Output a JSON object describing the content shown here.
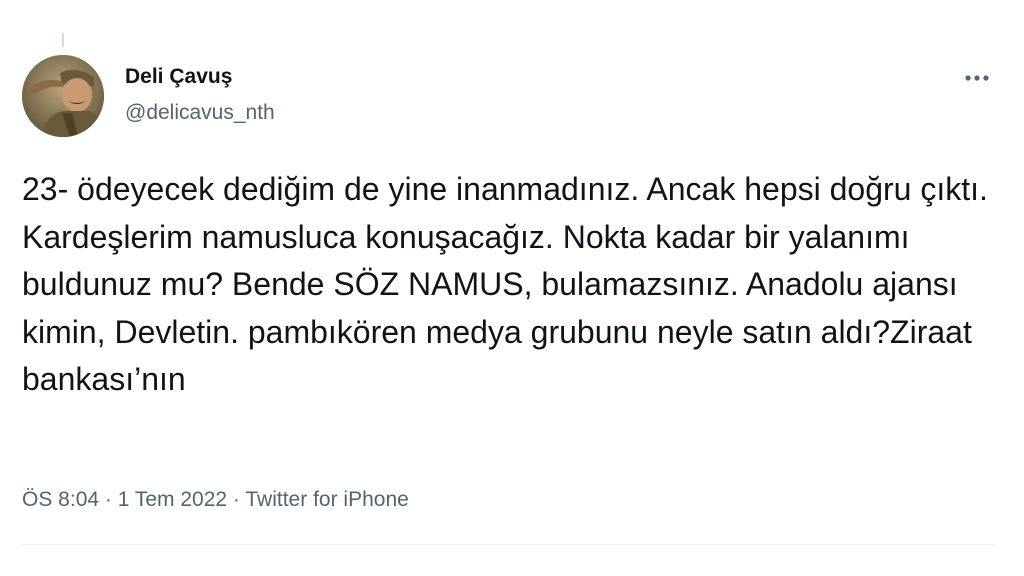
{
  "author": {
    "display_name": "Deli Çavuş",
    "handle": "@delicavus_nth",
    "avatar_icon": "profile-photo"
  },
  "more_icon": "more-horizontal-icon",
  "tweet": {
    "text": "23- ödeyecek dediğim de yine inanmadınız. Ancak hepsi doğru çıktı. Kardeşlerim namusluca konuşacağız. Nokta kadar bir yalanımı buldunuz mu? Bende SÖZ NAMUS, bulamazsınız. Anadolu ajansı kimin, Devletin. pambıkören medya grubunu neyle satın aldı?Ziraat bankası’nın"
  },
  "meta": {
    "time": "ÖS 8:04",
    "separator": " · ",
    "date": "1 Tem 2022",
    "source": "Twitter for iPhone"
  },
  "colors": {
    "text_primary": "#0f1419",
    "text_secondary": "#536471",
    "divider": "#eff3f4"
  }
}
